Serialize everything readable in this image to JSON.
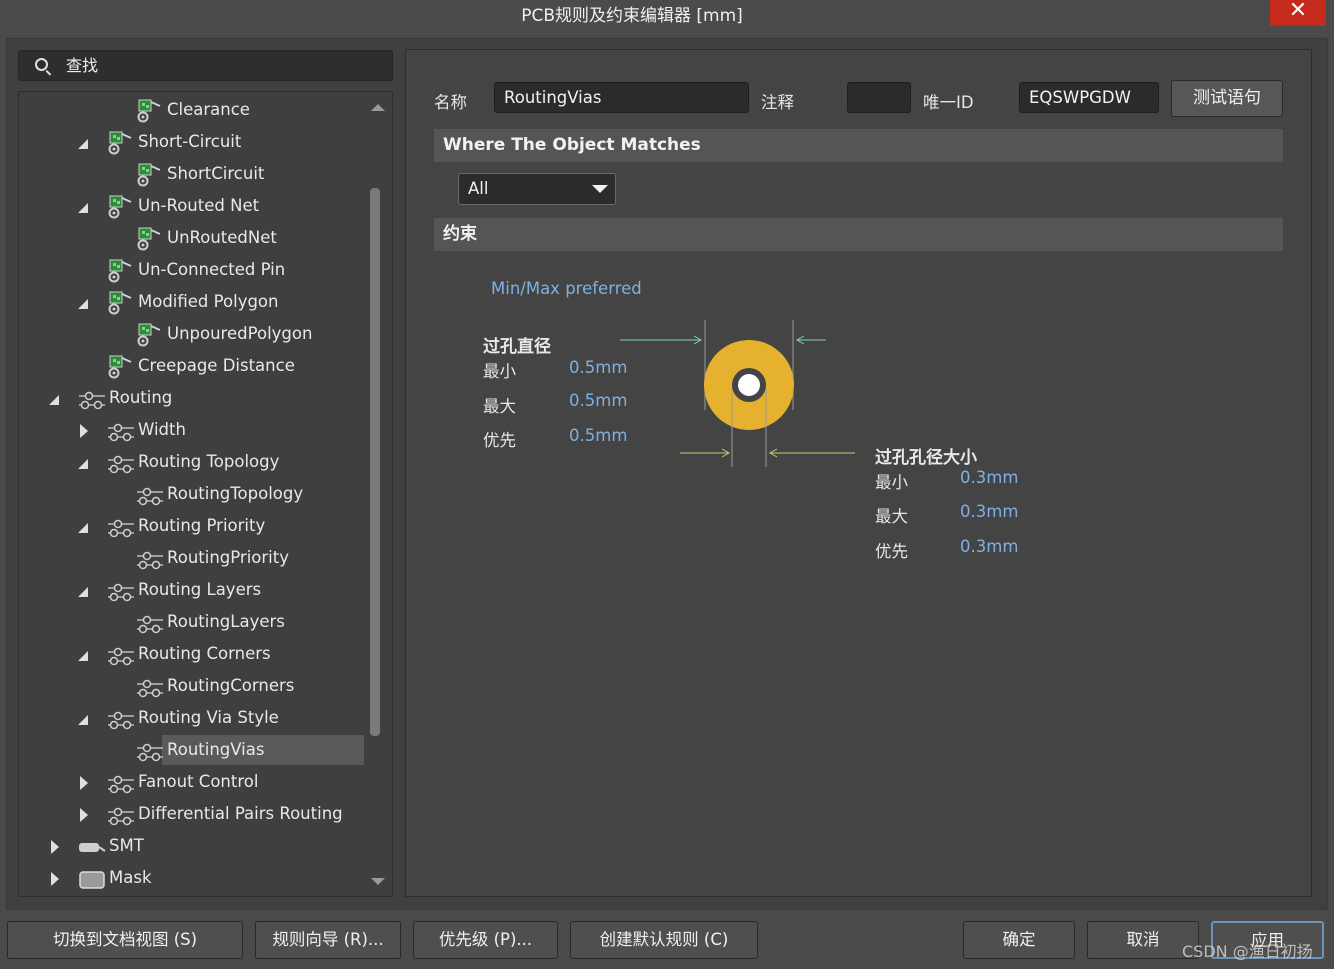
{
  "window": {
    "title": "PCB规则及约束编辑器 [mm]",
    "close_glyph": "✕"
  },
  "search": {
    "placeholder": "查找"
  },
  "tree": {
    "items": [
      {
        "label": "Clearance",
        "depth": 2,
        "twisty": "none",
        "icon": "rule-icon"
      },
      {
        "label": "Short-Circuit",
        "depth": 1,
        "twisty": "expanded",
        "icon": "rule-icon"
      },
      {
        "label": "ShortCircuit",
        "depth": 2,
        "twisty": "none",
        "icon": "rule-icon"
      },
      {
        "label": "Un-Routed Net",
        "depth": 1,
        "twisty": "expanded",
        "icon": "rule-icon"
      },
      {
        "label": "UnRoutedNet",
        "depth": 2,
        "twisty": "none",
        "icon": "rule-icon"
      },
      {
        "label": "Un-Connected Pin",
        "depth": 1,
        "twisty": "none",
        "icon": "rule-icon"
      },
      {
        "label": "Modified Polygon",
        "depth": 1,
        "twisty": "expanded",
        "icon": "rule-icon"
      },
      {
        "label": "UnpouredPolygon",
        "depth": 2,
        "twisty": "none",
        "icon": "rule-icon"
      },
      {
        "label": "Creepage Distance",
        "depth": 1,
        "twisty": "none",
        "icon": "rule-icon"
      },
      {
        "label": "Routing",
        "depth": 0,
        "twisty": "expanded",
        "icon": "routing-icon"
      },
      {
        "label": "Width",
        "depth": 1,
        "twisty": "collapsed",
        "icon": "routing-icon"
      },
      {
        "label": "Routing Topology",
        "depth": 1,
        "twisty": "expanded",
        "icon": "routing-icon"
      },
      {
        "label": "RoutingTopology",
        "depth": 2,
        "twisty": "none",
        "icon": "routing-icon"
      },
      {
        "label": "Routing Priority",
        "depth": 1,
        "twisty": "expanded",
        "icon": "routing-icon"
      },
      {
        "label": "RoutingPriority",
        "depth": 2,
        "twisty": "none",
        "icon": "routing-icon"
      },
      {
        "label": "Routing Layers",
        "depth": 1,
        "twisty": "expanded",
        "icon": "routing-icon"
      },
      {
        "label": "RoutingLayers",
        "depth": 2,
        "twisty": "none",
        "icon": "routing-icon"
      },
      {
        "label": "Routing Corners",
        "depth": 1,
        "twisty": "expanded",
        "icon": "routing-icon"
      },
      {
        "label": "RoutingCorners",
        "depth": 2,
        "twisty": "none",
        "icon": "routing-icon"
      },
      {
        "label": "Routing Via Style",
        "depth": 1,
        "twisty": "expanded",
        "icon": "routing-icon"
      },
      {
        "label": "RoutingVias",
        "depth": 2,
        "twisty": "none",
        "icon": "routing-icon",
        "selected": true
      },
      {
        "label": "Fanout Control",
        "depth": 1,
        "twisty": "collapsed",
        "icon": "routing-icon"
      },
      {
        "label": "Differential Pairs Routing",
        "depth": 1,
        "twisty": "collapsed",
        "icon": "routing-icon"
      },
      {
        "label": "SMT",
        "depth": 0,
        "twisty": "collapsed",
        "icon": "smt-icon"
      },
      {
        "label": "Mask",
        "depth": 0,
        "twisty": "collapsed",
        "icon": "mask-icon"
      }
    ]
  },
  "rule": {
    "name_label": "名称",
    "name_value": "RoutingVias",
    "comment_label": "注释",
    "comment_value": "",
    "uid_label": "唯一ID",
    "uid_value": "EQSWPGDW",
    "test_button": "测试语句"
  },
  "where": {
    "header": "Where The Object Matches",
    "match_value": "All"
  },
  "constraints": {
    "header": "约束",
    "mode": "Min/Max preferred",
    "via_diameter": {
      "title": "过孔直径",
      "rows": [
        {
          "label": "最小",
          "value": "0.5mm"
        },
        {
          "label": "最大",
          "value": "0.5mm"
        },
        {
          "label": "优先",
          "value": "0.5mm"
        }
      ]
    },
    "hole_size": {
      "title": "过孔孔径大小",
      "rows": [
        {
          "label": "最小",
          "value": "0.3mm"
        },
        {
          "label": "最大",
          "value": "0.3mm"
        },
        {
          "label": "优先",
          "value": "0.3mm"
        }
      ]
    },
    "via_color": "#e6b12e"
  },
  "buttons": {
    "doc_view": "切换到文档视图 (S)",
    "wizard": "规则向导 (R)...",
    "priority": "优先级 (P)...",
    "create_default": "创建默认规则 (C)",
    "ok": "确定",
    "cancel": "取消",
    "apply": "应用"
  },
  "watermark": "CSDN @渔日初扬"
}
